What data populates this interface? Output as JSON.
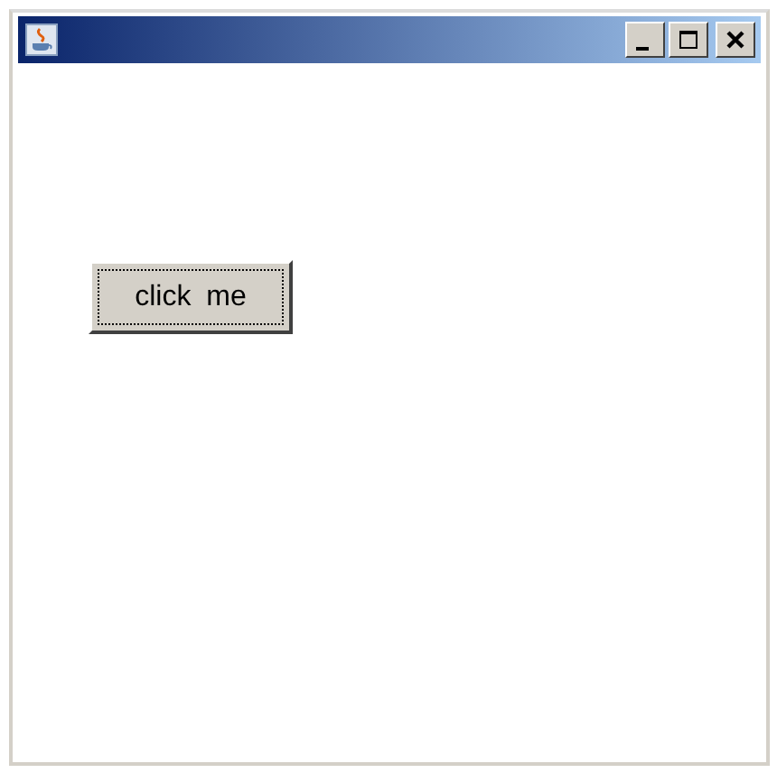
{
  "button": {
    "label": "click me",
    "focused": true
  }
}
